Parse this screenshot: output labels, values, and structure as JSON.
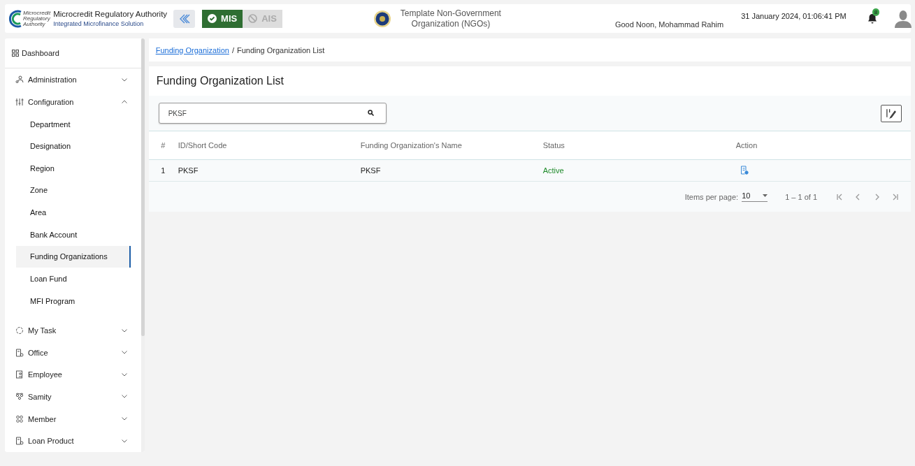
{
  "header": {
    "org_name": "Microcredit Regulatory Authority",
    "org_subtitle": "Integrated Microfinance Solution",
    "logo_text": [
      "Microcredit",
      "Regulatory",
      "Authority"
    ],
    "modules": [
      {
        "label": "MIS",
        "selected": true
      },
      {
        "label": "AIS",
        "selected": false
      }
    ],
    "ngo_name": "Template Non-Government Organization (NGOs)",
    "greeting": "Good Noon, Mohammad Rahim",
    "datetime": "31 January 2024, 01:06:41 PM",
    "notification_count": "8"
  },
  "sidebar": {
    "dashboard": "Dashboard",
    "items": [
      {
        "label": "Administration",
        "expanded": false
      },
      {
        "label": "Configuration",
        "expanded": true,
        "children": [
          {
            "label": "Department",
            "selected": false
          },
          {
            "label": "Designation",
            "selected": false
          },
          {
            "label": "Region",
            "selected": false
          },
          {
            "label": "Zone",
            "selected": false
          },
          {
            "label": "Area",
            "selected": false
          },
          {
            "label": "Bank Account",
            "selected": false
          },
          {
            "label": "Funding Organizations",
            "selected": true
          },
          {
            "label": "Loan Fund",
            "selected": false
          },
          {
            "label": "MFI Program",
            "selected": false
          }
        ]
      },
      {
        "label": "My Task",
        "expanded": false
      },
      {
        "label": "Office",
        "expanded": false
      },
      {
        "label": "Employee",
        "expanded": false
      },
      {
        "label": "Samity",
        "expanded": false
      },
      {
        "label": "Member",
        "expanded": false
      },
      {
        "label": "Loan Product",
        "expanded": false
      }
    ]
  },
  "breadcrumb": [
    {
      "label": "Funding Organization",
      "kind": "link"
    },
    {
      "label": "/",
      "kind": "sep"
    },
    {
      "label": "Funding Organization List",
      "kind": "current"
    }
  ],
  "page_title": "Funding Organization List",
  "search": {
    "value": "PKSF"
  },
  "table": {
    "columns": [
      "#",
      "ID/Short Code",
      "Funding Organization's Name",
      "Status",
      "Action"
    ],
    "rows": [
      {
        "number": "1",
        "code": "PKSF",
        "name": "PKSF",
        "status": "Active"
      }
    ]
  },
  "pagination": {
    "items_per_page_label": "Items per page:",
    "page_size": "10",
    "range": "1 – 1 of 1"
  }
}
